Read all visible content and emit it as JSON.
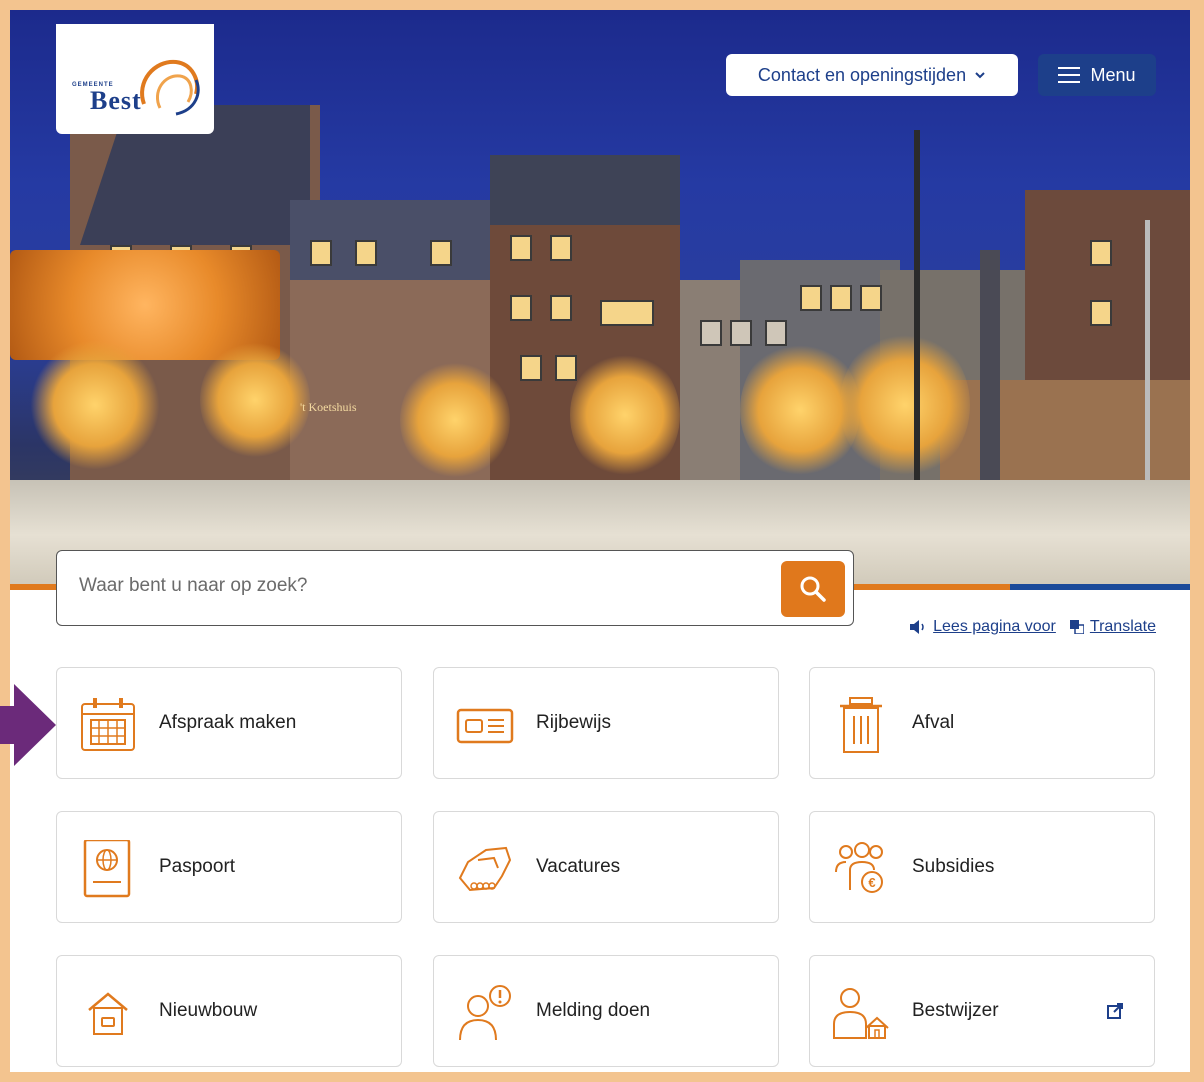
{
  "logo": {
    "small_text": "GEMEENTE",
    "word": "Best"
  },
  "header": {
    "contact_label": "Contact en openingstijden",
    "menu_label": "Menu"
  },
  "hero": {
    "sign_text": "'t Koetshuis"
  },
  "search": {
    "placeholder": "Waar bent u naar op zoek?"
  },
  "tools": {
    "read_aloud": "Lees pagina voor",
    "translate": "Translate"
  },
  "tiles": [
    {
      "label": "Afspraak maken",
      "icon": "calendar-icon"
    },
    {
      "label": "Rijbewijs",
      "icon": "driving-license-icon"
    },
    {
      "label": "Afval",
      "icon": "trash-bin-icon"
    },
    {
      "label": "Paspoort",
      "icon": "passport-icon"
    },
    {
      "label": "Vacatures",
      "icon": "handshake-icon"
    },
    {
      "label": "Subsidies",
      "icon": "people-euro-icon"
    },
    {
      "label": "Nieuwbouw",
      "icon": "house-icon"
    },
    {
      "label": "Melding doen",
      "icon": "person-alert-icon"
    },
    {
      "label": "Bestwijzer",
      "icon": "person-house-icon",
      "external": true
    }
  ],
  "colors": {
    "brand_blue": "#1d3f8a",
    "accent_orange": "#e0781c",
    "frame": "#f3c48f",
    "pointer_arrow": "#6b2a7a"
  }
}
